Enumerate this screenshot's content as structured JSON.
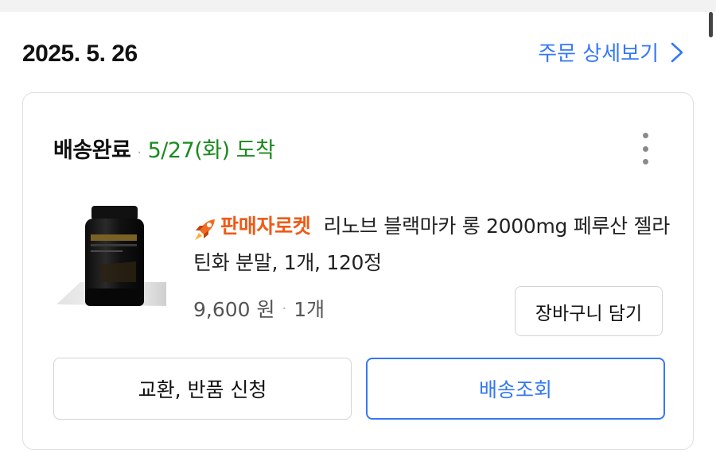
{
  "order": {
    "date": "2025. 5. 26",
    "detail_link": "주문 상세보기"
  },
  "shipment": {
    "status": "배송완료",
    "arrival": "5/27(화) 도착"
  },
  "product": {
    "badge": "판매자로켓",
    "title": "리노브 블랙마카 롱 2000mg 페루산 젤라틴화 분말, 1개, 120정",
    "price": "9,600 원",
    "quantity": "1개"
  },
  "buttons": {
    "add_to_cart": "장바구니 담기",
    "exchange_return": "교환, 반품 신청",
    "track_delivery": "배송조회"
  },
  "colors": {
    "accent_blue": "#3478f6",
    "status_green": "#1a8a1f",
    "badge_orange": "#f05a16"
  },
  "icons": {
    "detail_chevron": "chevron-right-icon",
    "more": "more-vertical-icon",
    "badge": "rocket-icon"
  }
}
